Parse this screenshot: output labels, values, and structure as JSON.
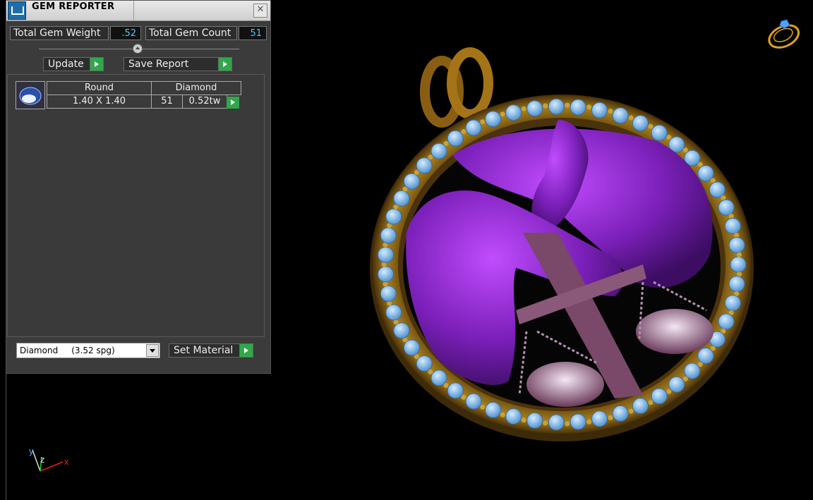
{
  "panel": {
    "title": "GEM REPORTER",
    "close_glyph": "✕",
    "total_weight_label": "Total Gem Weight",
    "total_weight_value": ".52",
    "total_count_label": "Total Gem Count",
    "total_count_value": "51",
    "update_label": "Update",
    "save_report_label": "Save Report",
    "gem_rows": [
      {
        "shape": "Round",
        "material": "Diamond",
        "size": "1.40 X 1.40",
        "count": "51",
        "weight": "0.52tw"
      }
    ],
    "material_select_value": "Diamond     (3.52 spg)",
    "set_material_label": "Set Material"
  },
  "viewport": {
    "axis_labels": {
      "y": "y",
      "z": "z",
      "x": "x"
    }
  },
  "icons": [
    "gem-reporter-icon",
    "close-icon",
    "play-arrow-icon",
    "round-gem-icon",
    "chevron-down-icon",
    "ring-view-icon",
    "axis-triad-icon"
  ]
}
